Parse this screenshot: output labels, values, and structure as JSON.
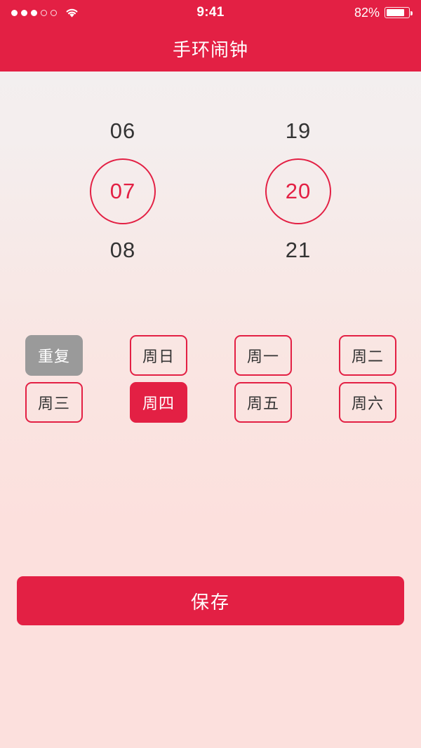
{
  "status_bar": {
    "signal_dots_filled": 3,
    "signal_dots_total": 5,
    "wifi_icon": "wifi-icon",
    "time": "9:41",
    "battery_percent": "82%",
    "battery_level": 82,
    "battery_icon": "battery-icon"
  },
  "header": {
    "title": "手环闹钟",
    "background_color": "#e32044"
  },
  "time_picker": {
    "hour": {
      "previous": "06",
      "selected": "07",
      "next": "08"
    },
    "minute": {
      "previous": "19",
      "selected": "20",
      "next": "21"
    }
  },
  "repeat": {
    "label": "重复",
    "days": [
      {
        "label": "周日",
        "selected": false
      },
      {
        "label": "周一",
        "selected": false
      },
      {
        "label": "周二",
        "selected": false
      },
      {
        "label": "周三",
        "selected": false
      },
      {
        "label": "周四",
        "selected": true
      },
      {
        "label": "周五",
        "selected": false
      },
      {
        "label": "周六",
        "selected": false
      }
    ]
  },
  "footer": {
    "save_label": "保存"
  },
  "colors": {
    "accent": "#e32044",
    "muted": "#9a9a9a",
    "text": "#333333",
    "bg_top": "#f2f0f0",
    "bg_bottom": "#fce0dd"
  }
}
